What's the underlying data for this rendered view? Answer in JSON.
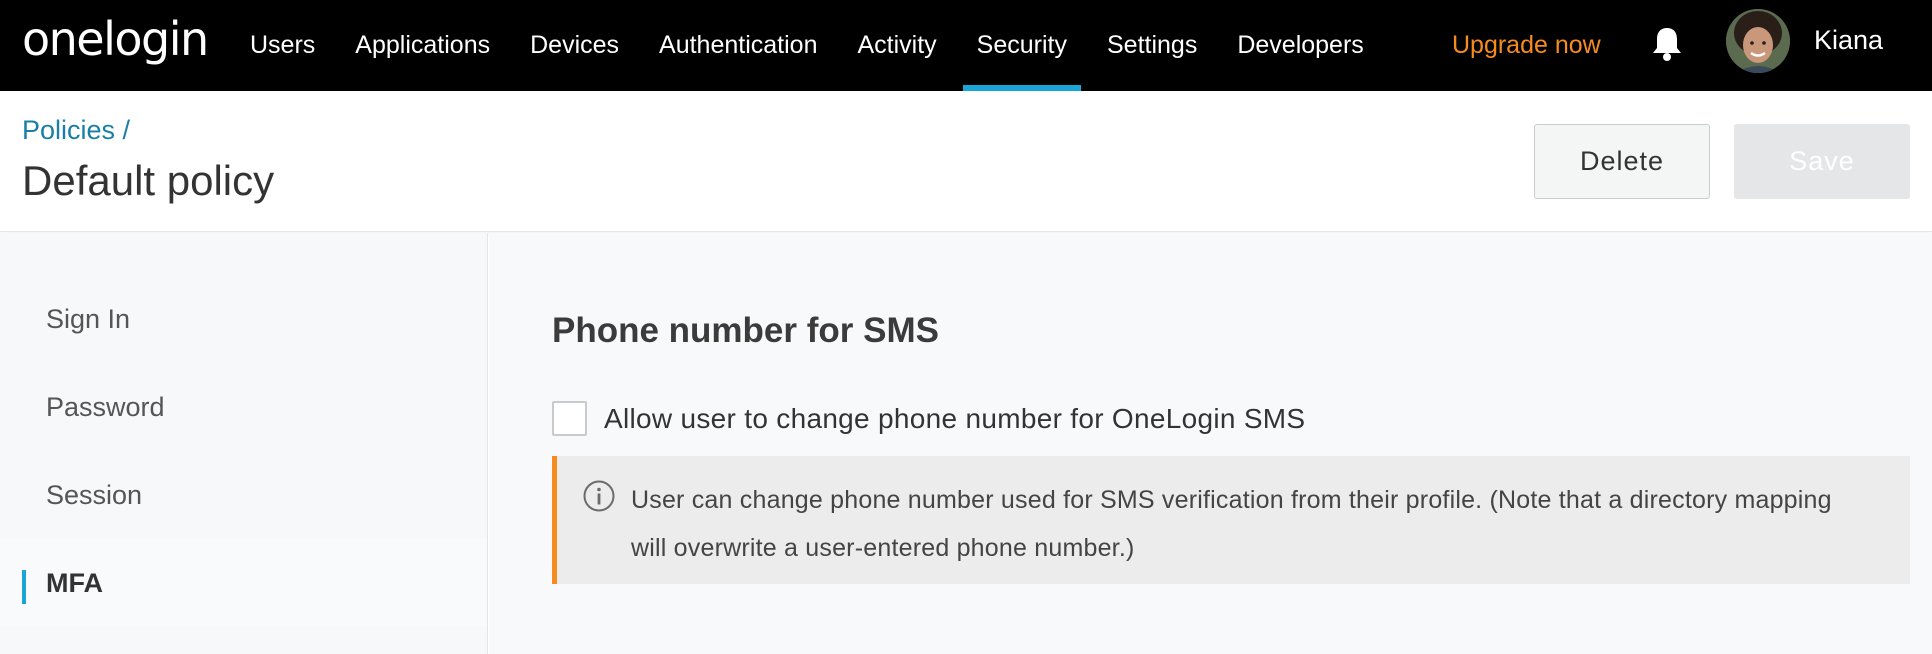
{
  "app": {
    "logo_text": "onelogin",
    "accent_color": "#1ca6d8",
    "upgrade_color": "#f68b1f"
  },
  "nav": {
    "items": [
      {
        "label": "Users"
      },
      {
        "label": "Applications"
      },
      {
        "label": "Devices"
      },
      {
        "label": "Authentication"
      },
      {
        "label": "Activity"
      },
      {
        "label": "Security",
        "active": true
      },
      {
        "label": "Settings"
      },
      {
        "label": "Developers"
      }
    ],
    "upgrade_label": "Upgrade now",
    "notifications_icon": "bell-icon",
    "user_name": "Kiana"
  },
  "header": {
    "breadcrumb": "Policies /",
    "title": "Default policy",
    "delete_label": "Delete",
    "save_label": "Save"
  },
  "sidebar": {
    "items": [
      {
        "label": "Sign In"
      },
      {
        "label": "Password"
      },
      {
        "label": "Session"
      },
      {
        "label": "MFA",
        "active": true
      }
    ]
  },
  "main": {
    "section_title": "Phone number for SMS",
    "checkbox_label": "Allow user to change phone number for OneLogin SMS",
    "checkbox_checked": false,
    "info_icon": "info-icon",
    "info_text": "User can change phone number used for SMS verification from their profile. (Note that a directory mapping will overwrite a user-entered phone number.)"
  }
}
